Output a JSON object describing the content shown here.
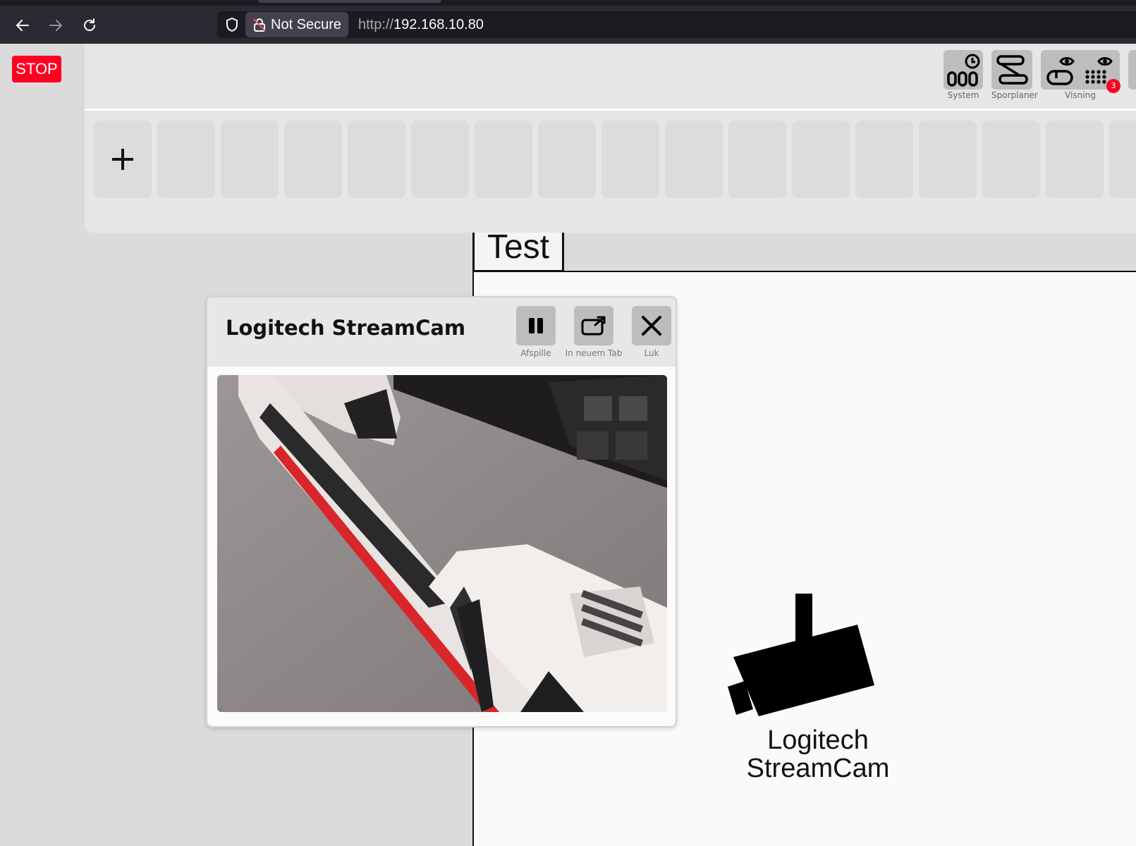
{
  "browser": {
    "security_label": "Not Secure",
    "url_scheme": "http://",
    "url_host": "192.168.10.80"
  },
  "app": {
    "stop_label": "STOP",
    "toolbar": [
      {
        "label": "System",
        "icon": "system-clock-icon"
      },
      {
        "label": "Sporplaner",
        "icon": "track-plan-icon"
      },
      {
        "label": "Visning",
        "icon": "view-eye-icon",
        "badge": "3"
      }
    ],
    "add_slot_label": "+",
    "layout_tab": "Test",
    "camera_widget_label": "Logitech StreamCam"
  },
  "dialog": {
    "title": "Logitech StreamCam",
    "buttons": [
      {
        "label": "Afspille",
        "icon": "pause-icon"
      },
      {
        "label": "In neuem Tab",
        "icon": "open-new-tab-icon"
      },
      {
        "label": "Luk",
        "icon": "close-icon"
      }
    ]
  },
  "colors": {
    "stop": "#ff0022",
    "panel": "#e6e6e6",
    "tile": "#bdbdbd",
    "browser_chrome": "#2b2a33"
  }
}
